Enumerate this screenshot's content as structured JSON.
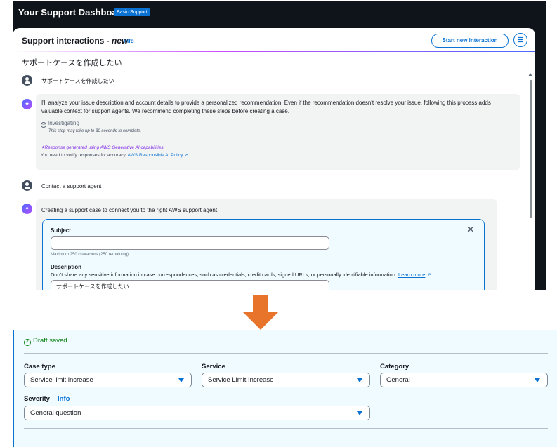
{
  "dashboard": {
    "title": "Your Support Dashboard",
    "badge": "Basic Support"
  },
  "panel": {
    "title_prefix": "Support interactions - ",
    "title_emphasis": "new",
    "info": "Info",
    "start_button": "Start new interaction",
    "case_heading": "サポートケースを作成したい"
  },
  "conversation": {
    "user_msg_1": "サポートケースを作成したい",
    "ai_msg_1": "I'll analyze your issue description and account details to provide a personalized recommendation. Even if the recommendation doesn't resolve your issue, following this process adds valuable context for support agents. We recommend completing these steps before creating a case.",
    "status": "Investigating",
    "status_note": "This step may take up to 30 seconds to complete.",
    "gen_note": "Response generated using AWS Generative AI capabilities.",
    "verify_note": "You need to verify responses for accuracy.",
    "verify_link": "AWS Responsible AI Policy",
    "user_msg_2": "Contact a support agent",
    "ai_msg_2": "Creating a support case to connect you to the right AWS support agent."
  },
  "case_form": {
    "subject_label": "Subject",
    "subject_value": "",
    "subject_hint": "Maximum 250 characters (250 remaining)",
    "description_label": "Description",
    "description_help": "Don't share any sensitive information in case correspondences, such as credentials, credit cards, signed URLs, or personally identifiable information.",
    "learn_more": "Learn more",
    "description_value": "サポートケースを作成したい"
  },
  "details_form": {
    "draft_status": "Draft saved",
    "case_type_label": "Case type",
    "case_type_value": "Service limit increase",
    "service_label": "Service",
    "service_value": "Service Limit Increase",
    "category_label": "Category",
    "category_value": "General",
    "severity_label": "Severity",
    "severity_info": "Info",
    "severity_value": "General question"
  },
  "colors": {
    "accent": "#0972d3",
    "arrow": "#e8742b",
    "success": "#037f0c",
    "header_bg": "#0f141a"
  }
}
